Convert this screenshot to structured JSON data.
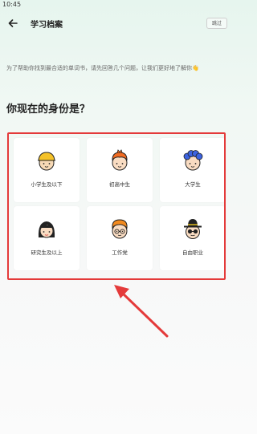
{
  "status_bar": {
    "time": "10:45"
  },
  "nav": {
    "title": "学习档案",
    "skip_label": "跳过",
    "back_icon": "back-arrow-icon"
  },
  "intro": {
    "text": "为了帮助你找到最合适的单词书，请先回答几个问题，让我们更好地了解你👋"
  },
  "question": "你现在的身份是？",
  "options": [
    {
      "label": "小学生及以下",
      "icon": "child-yellow-cap-avatar"
    },
    {
      "label": "初高中生",
      "icon": "teen-orange-hair-avatar"
    },
    {
      "label": "大学生",
      "icon": "student-blue-hair-avatar"
    },
    {
      "label": "研究生及以上",
      "icon": "graduate-black-hair-avatar"
    },
    {
      "label": "工作党",
      "icon": "worker-glasses-avatar"
    },
    {
      "label": "自由职业",
      "icon": "freelancer-hat-sunglasses-avatar"
    }
  ],
  "colors": {
    "highlight": "#e43a3a",
    "background_top": "#e6f5ee",
    "card": "#ffffff"
  }
}
